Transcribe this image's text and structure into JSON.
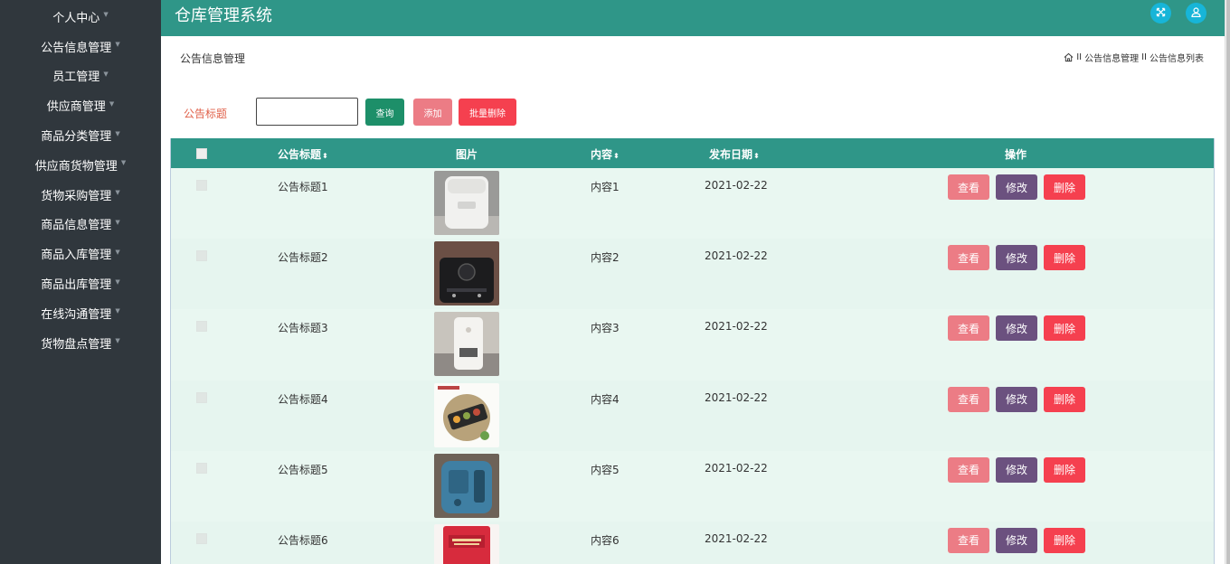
{
  "sidebar": {
    "items": [
      {
        "label": "个人中心"
      },
      {
        "label": "公告信息管理"
      },
      {
        "label": "员工管理"
      },
      {
        "label": "供应商管理"
      },
      {
        "label": "商品分类管理"
      },
      {
        "label": "供应商货物管理"
      },
      {
        "label": "货物采购管理"
      },
      {
        "label": "商品信息管理"
      },
      {
        "label": "商品入库管理"
      },
      {
        "label": "商品出库管理"
      },
      {
        "label": "在线沟通管理"
      },
      {
        "label": "货物盘点管理"
      }
    ]
  },
  "header": {
    "title": "仓库管理系统",
    "icons": [
      "fullscreen-icon",
      "user-icon"
    ]
  },
  "page": {
    "title": "公告信息管理",
    "breadcrumb": {
      "sep": "II",
      "items": [
        "公告信息管理",
        "公告信息列表"
      ]
    }
  },
  "search": {
    "label": "公告标题",
    "value": "",
    "query_label": "查询",
    "add_label": "添加",
    "batch_delete_label": "批量删除"
  },
  "table": {
    "columns": {
      "title": "公告标题",
      "image": "图片",
      "content": "内容",
      "date": "发布日期",
      "actions": "操作"
    },
    "rows": [
      {
        "title": "公告标题1",
        "content": "内容1",
        "date": "2021-02-22"
      },
      {
        "title": "公告标题2",
        "content": "内容2",
        "date": "2021-02-22"
      },
      {
        "title": "公告标题3",
        "content": "内容3",
        "date": "2021-02-22"
      },
      {
        "title": "公告标题4",
        "content": "内容4",
        "date": "2021-02-22"
      },
      {
        "title": "公告标题5",
        "content": "内容5",
        "date": "2021-02-22"
      },
      {
        "title": "公告标题6",
        "content": "内容6",
        "date": "2021-02-22"
      }
    ],
    "action_labels": {
      "view": "查看",
      "edit": "修改",
      "delete": "删除"
    }
  },
  "colors": {
    "primary": "#2f9688",
    "sidebar": "#30373d",
    "query": "#1d8f69",
    "pink": "#ec7c85",
    "red": "#f5404f",
    "purple": "#6b517f"
  }
}
